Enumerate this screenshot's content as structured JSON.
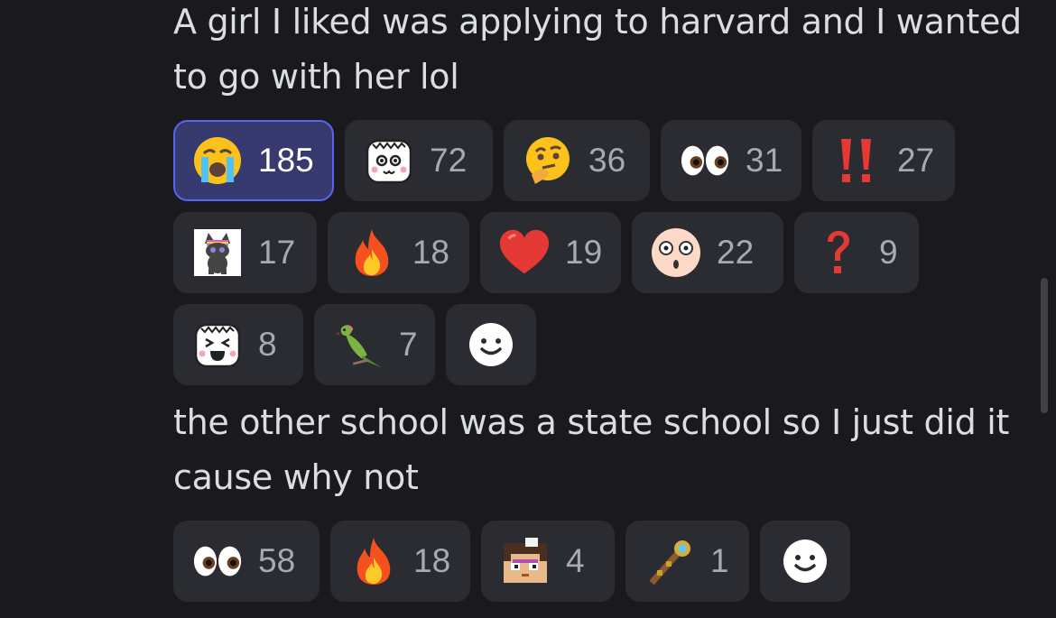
{
  "messages": [
    {
      "text": "A girl I liked was applying to harvard and I wanted to go with her lol",
      "reactions": [
        {
          "icon": "loudly-crying-face-icon",
          "count": "185",
          "selected": true
        },
        {
          "icon": "tofu-face-icon",
          "count": "72"
        },
        {
          "icon": "thinking-face-icon",
          "count": "36"
        },
        {
          "icon": "eyes-icon",
          "count": "31"
        },
        {
          "icon": "double-exclamation-icon",
          "count": "27"
        },
        {
          "icon": "rainbow-cat-sticker-icon",
          "count": "17"
        },
        {
          "icon": "fire-icon",
          "count": "18"
        },
        {
          "icon": "red-heart-icon",
          "count": "19"
        },
        {
          "icon": "surprised-face-icon",
          "count": "22"
        },
        {
          "icon": "question-mark-icon",
          "count": "9"
        },
        {
          "icon": "laughing-tofu-face-icon",
          "count": "8"
        },
        {
          "icon": "parrot-icon",
          "count": "7"
        }
      ]
    },
    {
      "text": "the other school was a state school so I just did it cause why not",
      "reactions": [
        {
          "icon": "eyes-icon",
          "count": "58"
        },
        {
          "icon": "fire-icon",
          "count": "18"
        },
        {
          "icon": "pixel-avatar-icon",
          "count": "4"
        },
        {
          "icon": "pixel-staff-icon",
          "count": "1"
        }
      ]
    }
  ],
  "colors": {
    "selected_border": "#5865f2",
    "selected_bg": "#373a6e",
    "pill_bg": "#2b2c31",
    "background": "#1a1a1e"
  }
}
